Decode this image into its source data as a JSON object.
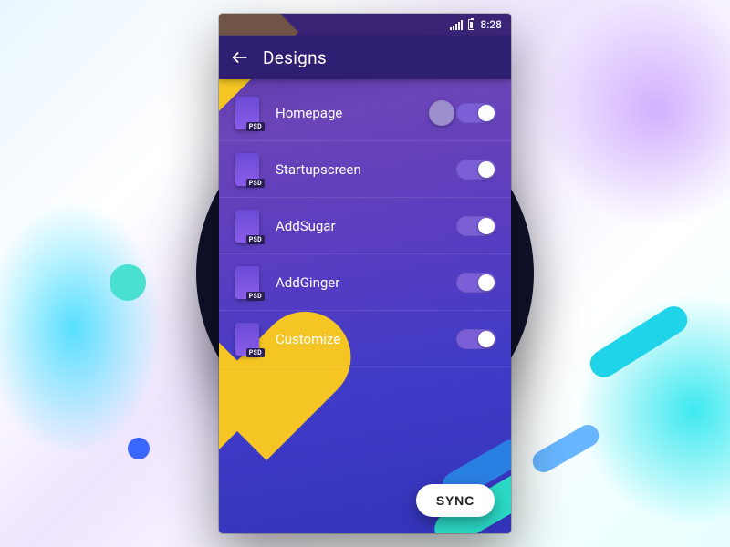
{
  "statusbar": {
    "time": "8:28"
  },
  "appbar": {
    "title": "Designs"
  },
  "psd_tag": "PSD",
  "items": [
    {
      "label": "Homepage",
      "on": true,
      "hint_knob": true
    },
    {
      "label": "Startupscreen",
      "on": true,
      "hint_knob": false
    },
    {
      "label": "AddSugar",
      "on": true,
      "hint_knob": false
    },
    {
      "label": "AddGinger",
      "on": true,
      "hint_knob": false
    },
    {
      "label": "Customize",
      "on": true,
      "hint_knob": false
    }
  ],
  "sync_label": "SYNC"
}
